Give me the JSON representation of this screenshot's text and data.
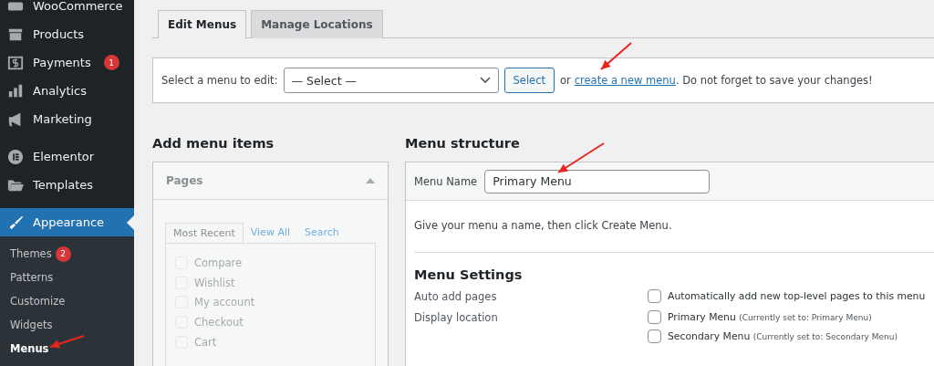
{
  "sidebar": {
    "groups": [
      [
        {
          "label": "WooCommerce",
          "selected": false
        },
        {
          "label": "Products",
          "selected": false
        },
        {
          "label": "Payments",
          "badge": "1",
          "selected": false
        },
        {
          "label": "Analytics",
          "selected": false
        },
        {
          "label": "Marketing",
          "selected": false
        }
      ],
      [
        {
          "label": "Elementor",
          "selected": false
        },
        {
          "label": "Templates",
          "selected": false
        }
      ],
      [
        {
          "label": "Appearance",
          "selected": true
        }
      ]
    ],
    "submenu": [
      {
        "label": "Themes",
        "badge": "2",
        "selected": false
      },
      {
        "label": "Patterns",
        "selected": false
      },
      {
        "label": "Customize",
        "selected": false
      },
      {
        "label": "Widgets",
        "selected": false
      },
      {
        "label": "Menus",
        "selected": true
      }
    ]
  },
  "tabs": [
    {
      "label": "Edit Menus",
      "selected": true
    },
    {
      "label": "Manage Locations",
      "selected": false
    }
  ],
  "menu_select": {
    "label": "Select a menu to edit:",
    "value": "— Select —",
    "button": "Select",
    "text_before": "or",
    "link": "create a new menu",
    "text_after": ". Do not forget to save your changes!"
  },
  "add_menu_items": {
    "title": "Add menu items",
    "panel": {
      "title": "Pages",
      "expanded": true,
      "tabs": [
        {
          "label": "Most Recent",
          "selected": true
        },
        {
          "label": "View All",
          "selected": false
        },
        {
          "label": "Search",
          "selected": false
        }
      ],
      "items": [
        {
          "label": "Compare",
          "checked": false,
          "disabled": true
        },
        {
          "label": "Wishlist",
          "checked": false,
          "disabled": true
        },
        {
          "label": "My account",
          "checked": false,
          "disabled": true
        },
        {
          "label": "Checkout",
          "checked": false,
          "disabled": true
        },
        {
          "label": "Cart",
          "checked": false,
          "disabled": true
        }
      ]
    }
  },
  "menu_structure": {
    "title": "Menu structure",
    "name_label": "Menu Name",
    "name_value": "Primary Menu",
    "hint": "Give your menu a name, then click Create Menu.",
    "settings_title": "Menu Settings",
    "settings": [
      {
        "label": "Auto add pages",
        "options": [
          {
            "label": "Automatically add new top-level pages to this menu",
            "checked": false
          }
        ]
      },
      {
        "label": "Display location",
        "options": [
          {
            "label": "Primary Menu",
            "note": "(Currently set to: Primary Menu)",
            "checked": false
          },
          {
            "label": "Secondary Menu",
            "note": "(Currently set to: Secondary Menu)",
            "checked": false
          }
        ]
      }
    ]
  }
}
